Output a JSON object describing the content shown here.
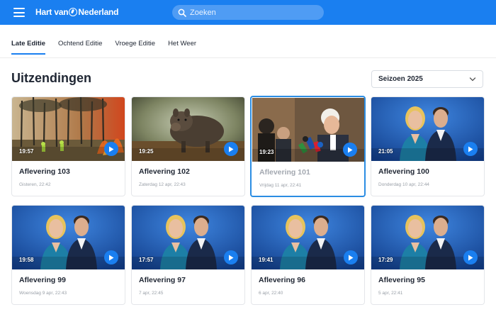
{
  "header": {
    "brand": "Hart van Nederland",
    "brand_part1": "Hart van",
    "brand_part2": "Nederland",
    "search_placeholder": "Zoeken",
    "bar_color": "#1a7ff0"
  },
  "tabs": [
    {
      "label": "Late Editie",
      "active": true
    },
    {
      "label": "Ochtend Editie",
      "active": false
    },
    {
      "label": "Vroege Editie",
      "active": false
    },
    {
      "label": "Het Weer",
      "active": false
    }
  ],
  "page": {
    "title": "Uitzendingen",
    "season_select": "Seizoen 2025"
  },
  "episodes": [
    {
      "title": "Aflevering 103",
      "date": "Gisteren, 22:42",
      "duration": "19:57",
      "thumb": "forest-fire",
      "selected": false
    },
    {
      "title": "Aflevering 102",
      "date": "Zaterdag 12 apr, 22:43",
      "duration": "19:25",
      "thumb": "wild-boar",
      "selected": false
    },
    {
      "title": "Aflevering 101",
      "date": "Vrijdag 11 apr, 22:41",
      "duration": "19:23",
      "thumb": "press-interview",
      "selected": true
    },
    {
      "title": "Aflevering 100",
      "date": "Donderdag 10 apr, 22:44",
      "duration": "21:05",
      "thumb": "presenters",
      "selected": false
    },
    {
      "title": "Aflevering 99",
      "date": "Woensdag 9 apr, 22:43",
      "duration": "19:58",
      "thumb": "presenters",
      "selected": false
    },
    {
      "title": "Aflevering 97",
      "date": "7 apr, 22:45",
      "duration": "17:57",
      "thumb": "presenters",
      "selected": false
    },
    {
      "title": "Aflevering 96",
      "date": "6 apr, 22:40",
      "duration": "19:41",
      "thumb": "presenters",
      "selected": false
    },
    {
      "title": "Aflevering 95",
      "date": "5 apr, 22:41",
      "duration": "17:29",
      "thumb": "presenters",
      "selected": false
    }
  ]
}
